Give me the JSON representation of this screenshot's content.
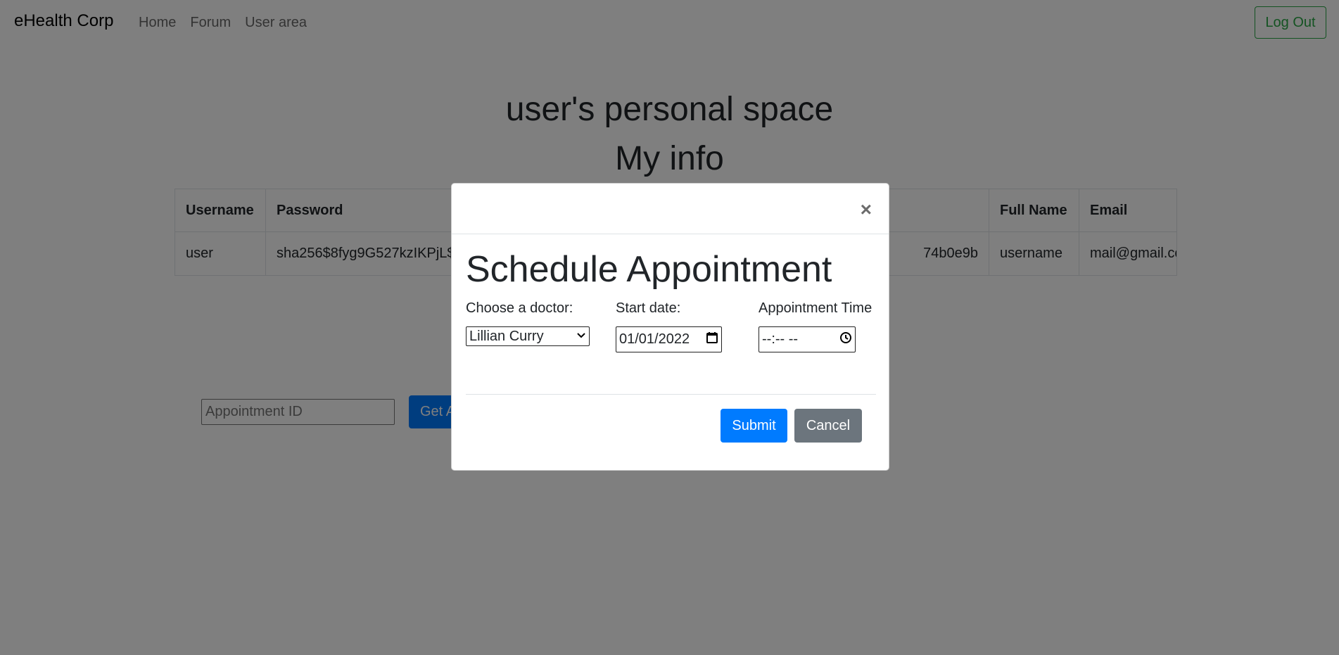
{
  "navbar": {
    "brand": "eHealth Corp",
    "links": [
      "Home",
      "Forum",
      "User area"
    ],
    "logout_label": "Log Out"
  },
  "page": {
    "heading": "user's personal space",
    "subheading": "My info"
  },
  "info_table": {
    "headers": [
      "Username",
      "Password",
      "",
      "Full Name",
      "Email"
    ],
    "row": [
      "user",
      "sha256$8fyg9G527kzIKPjL$",
      "74b0e9b",
      "username",
      "mail@gmail.com"
    ]
  },
  "appointment_lookup": {
    "placeholder": "Appointment ID",
    "button_label": "Get A"
  },
  "modal": {
    "close_symbol": "×",
    "title": "Schedule Appointment",
    "doctor_label": "Choose a doctor:",
    "doctor_selected": "Lillian Curry",
    "date_label": "Start date:",
    "date_value": "01/01/2022",
    "time_label": "Appointment Time",
    "time_value": "--:-- --",
    "submit_label": "Submit",
    "cancel_label": "Cancel"
  },
  "colors": {
    "primary": "#007bff",
    "secondary": "#6c757d",
    "success": "#28a745",
    "backdrop": "rgba(0,0,0,0.5)"
  }
}
